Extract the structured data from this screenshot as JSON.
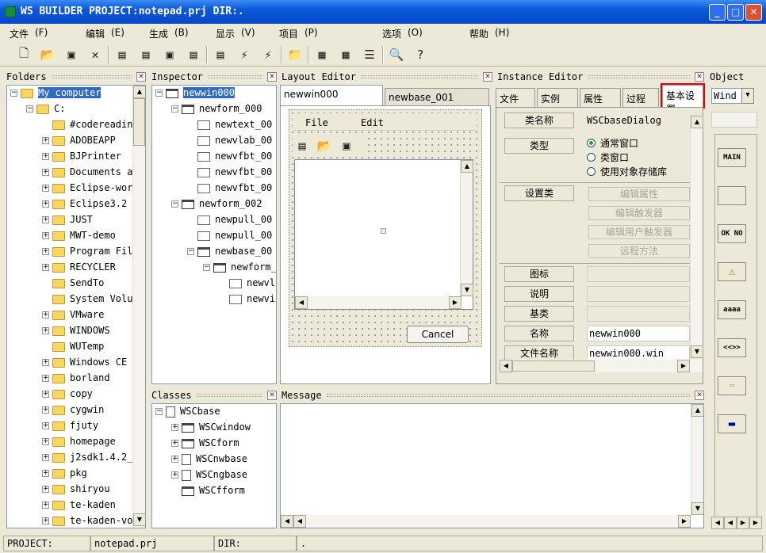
{
  "window": {
    "title": "WS BUILDER PROJECT:notepad.prj DIR:."
  },
  "menu": [
    {
      "label": "文件",
      "key": "(F)"
    },
    {
      "label": "编辑",
      "key": "(E)"
    },
    {
      "label": "生成",
      "key": "(B)"
    },
    {
      "label": "显示",
      "key": "(V)"
    },
    {
      "label": "项目",
      "key": "(P)"
    },
    {
      "label": "选项",
      "key": "(O)"
    },
    {
      "label": "帮助",
      "key": "(H)"
    }
  ],
  "toolbar_icons": [
    "new-file-icon",
    "open-folder-icon",
    "save-icon",
    "cut-icon",
    "window-icon",
    "open-window-icon",
    "save-window-icon",
    "close-window-icon",
    "search-window-icon",
    "build-icon",
    "build-all-icon",
    "folder-icon",
    "grid-icon",
    "delete-grid-icon",
    "list-icon",
    "preview-icon",
    "help-icon"
  ],
  "folders": {
    "title": "Folders",
    "items": [
      {
        "label": "My computer",
        "exp": "-",
        "icon": "folder",
        "sel": true
      },
      {
        "label": "C:",
        "exp": "-",
        "icon": "folder"
      },
      {
        "label": "#codereadin",
        "exp": "",
        "icon": "folder"
      },
      {
        "label": "ADOBEAPP",
        "exp": "+",
        "icon": "folder"
      },
      {
        "label": "BJPrinter",
        "exp": "+",
        "icon": "folder"
      },
      {
        "label": "Documents a",
        "exp": "+",
        "icon": "folder"
      },
      {
        "label": "Eclipse-wor",
        "exp": "+",
        "icon": "folder"
      },
      {
        "label": "Eclipse3.2",
        "exp": "+",
        "icon": "folder"
      },
      {
        "label": "JUST",
        "exp": "+",
        "icon": "folder"
      },
      {
        "label": "MWT-demo",
        "exp": "+",
        "icon": "folder"
      },
      {
        "label": "Program Fil",
        "exp": "+",
        "icon": "folder"
      },
      {
        "label": "RECYCLER",
        "exp": "+",
        "icon": "folder"
      },
      {
        "label": "SendTo",
        "exp": "",
        "icon": "folder"
      },
      {
        "label": "System Volu",
        "exp": "",
        "icon": "folder"
      },
      {
        "label": "VMware",
        "exp": "+",
        "icon": "folder"
      },
      {
        "label": "WINDOWS",
        "exp": "+",
        "icon": "folder"
      },
      {
        "label": "WUTemp",
        "exp": "",
        "icon": "folder"
      },
      {
        "label": "Windows CE",
        "exp": "+",
        "icon": "folder"
      },
      {
        "label": "borland",
        "exp": "+",
        "icon": "folder"
      },
      {
        "label": "copy",
        "exp": "+",
        "icon": "folder"
      },
      {
        "label": "cygwin",
        "exp": "+",
        "icon": "folder"
      },
      {
        "label": "fjuty",
        "exp": "+",
        "icon": "folder"
      },
      {
        "label": "homepage",
        "exp": "+",
        "icon": "folder"
      },
      {
        "label": "j2sdk1.4.2_",
        "exp": "+",
        "icon": "folder"
      },
      {
        "label": "pkg",
        "exp": "+",
        "icon": "folder"
      },
      {
        "label": "shiryou",
        "exp": "+",
        "icon": "folder"
      },
      {
        "label": "te-kaden",
        "exp": "+",
        "icon": "folder"
      },
      {
        "label": "te-kaden-vo",
        "exp": "+",
        "icon": "folder"
      }
    ]
  },
  "inspector": {
    "title": "Inspector",
    "items": [
      {
        "label": "newwin000",
        "exp": "-",
        "icon": "win",
        "sel": true
      },
      {
        "label": "newform_000",
        "exp": "-",
        "icon": "win"
      },
      {
        "label": "newtext_00",
        "exp": "",
        "icon": "ctl"
      },
      {
        "label": "newvlab_00",
        "exp": "",
        "icon": "ctl"
      },
      {
        "label": "newvfbt_00",
        "exp": "",
        "icon": "ctl"
      },
      {
        "label": "newvfbt_00",
        "exp": "",
        "icon": "ctl"
      },
      {
        "label": "newvfbt_00",
        "exp": "",
        "icon": "ctl"
      },
      {
        "label": "newform_002",
        "exp": "-",
        "icon": "win"
      },
      {
        "label": "newpull_00",
        "exp": "",
        "icon": "ctl"
      },
      {
        "label": "newpull_00",
        "exp": "",
        "icon": "ctl"
      },
      {
        "label": "newbase_00",
        "exp": "-",
        "icon": "win"
      },
      {
        "label": "newform_",
        "exp": "-",
        "icon": "win"
      },
      {
        "label": "newvl",
        "exp": "",
        "icon": "ctl"
      },
      {
        "label": "newvi",
        "exp": "",
        "icon": "ctl"
      }
    ]
  },
  "classes": {
    "title": "Classes",
    "items": [
      {
        "label": "WSCbase",
        "exp": "-",
        "icon": "doc"
      },
      {
        "label": "WSCwindow",
        "exp": "+",
        "icon": "win"
      },
      {
        "label": "WSCform",
        "exp": "+",
        "icon": "win"
      },
      {
        "label": "WSCnwbase",
        "exp": "+",
        "icon": "doc"
      },
      {
        "label": "WSCngbase",
        "exp": "+",
        "icon": "doc"
      },
      {
        "label": "WSCfform",
        "exp": "",
        "icon": "win"
      }
    ]
  },
  "layout": {
    "title": "Layout Editor",
    "tabs": [
      "newwin000",
      "newbase_001"
    ],
    "menu_file": "File",
    "menu_edit": "Edit",
    "cancel": "Cancel"
  },
  "instance": {
    "title": "Instance Editor",
    "tabs": [
      "文件",
      "实例",
      "属性",
      "过程",
      "基本设置"
    ],
    "class_name_label": "类名称",
    "class_name_value": "WSCbaseDialog",
    "type_label": "类型",
    "radio": [
      "通常窗口",
      "类窗口",
      "使用对象存储库"
    ],
    "setting_label": "设置类",
    "setting_buttons": [
      "编辑属性",
      "编辑触发器",
      "编辑用户触发器",
      "远程方法"
    ],
    "rows": [
      {
        "label": "图标",
        "value": ""
      },
      {
        "label": "说明",
        "value": ""
      },
      {
        "label": "基类",
        "value": ""
      },
      {
        "label": "名称",
        "value": "newwin000"
      },
      {
        "label": "文件名称",
        "value": "newwin000.win"
      }
    ]
  },
  "object": {
    "title": "Object",
    "select": "Wind",
    "palette": [
      "MAIN",
      "",
      "OK NO",
      "⚠",
      "aaaa",
      "<<>>",
      "folder",
      "bar"
    ]
  },
  "message": {
    "title": "Message"
  },
  "status": {
    "project_label": "PROJECT:",
    "project": "notepad.prj",
    "dir_label": "DIR:",
    "dir": "."
  }
}
